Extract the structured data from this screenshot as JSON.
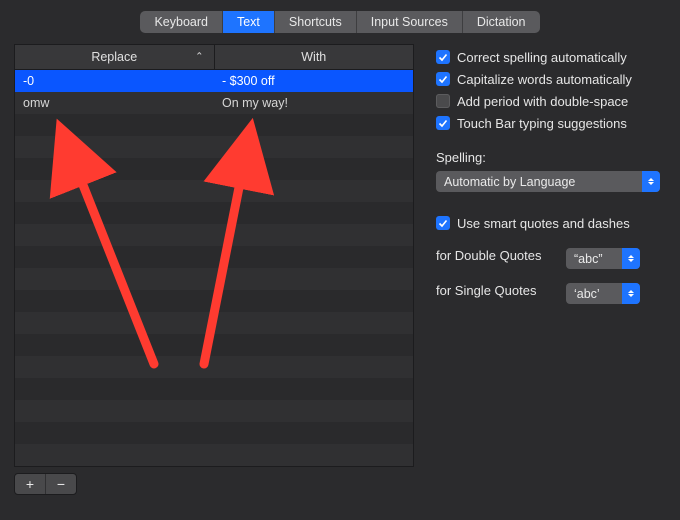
{
  "tabs": {
    "items": [
      "Keyboard",
      "Text",
      "Shortcuts",
      "Input Sources",
      "Dictation"
    ],
    "active_index": 1
  },
  "table": {
    "columns": {
      "replace": "Replace",
      "with": "With"
    },
    "sort_indicator": "⌃",
    "rows": [
      {
        "replace": "-0",
        "with": "- $300 off",
        "selected": true
      },
      {
        "replace": "omw",
        "with": "On my way!",
        "selected": false
      }
    ],
    "empty_rows": 16,
    "buttons": {
      "add": "+",
      "remove": "−"
    }
  },
  "checks": {
    "correct_spelling": {
      "label": "Correct spelling automatically",
      "checked": true
    },
    "capitalize_words": {
      "label": "Capitalize words automatically",
      "checked": true
    },
    "add_period": {
      "label": "Add period with double-space",
      "checked": false
    },
    "touch_bar": {
      "label": "Touch Bar typing suggestions",
      "checked": true
    }
  },
  "spelling": {
    "label": "Spelling:",
    "value": "Automatic by Language"
  },
  "smart_quotes": {
    "label": "Use smart quotes and dashes",
    "checked": true,
    "double_label": "for Double Quotes",
    "double_value": "“abc”",
    "single_label": "for Single Quotes",
    "single_value": "‘abc’"
  },
  "annotation": {
    "color": "#ff3b30"
  }
}
